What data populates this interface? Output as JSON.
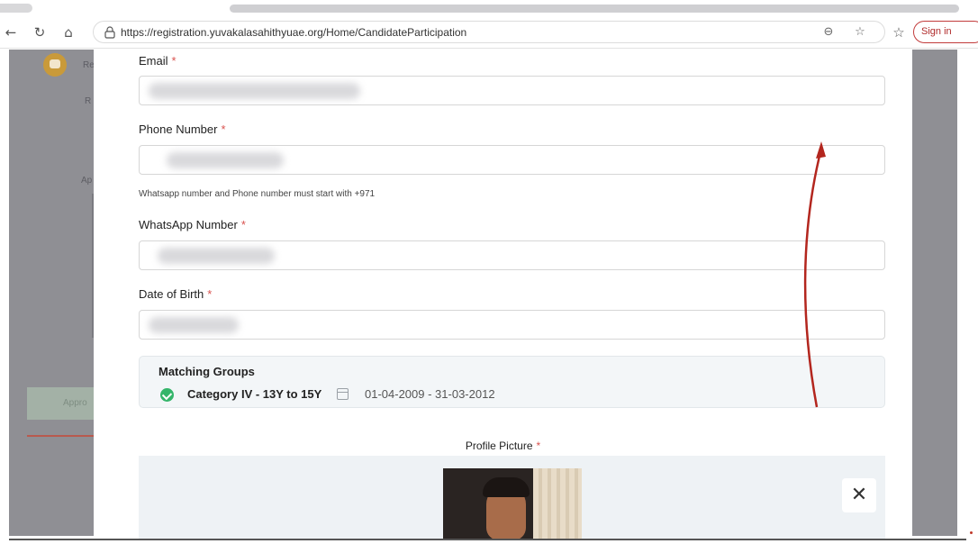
{
  "browser": {
    "url": "https://registration.yuvakalasahithyuae.org/Home/CandidateParticipation",
    "sign_in_label": "Sign in",
    "icons": [
      "back-icon",
      "reload-icon",
      "home-icon",
      "site-info-icon",
      "more-options-icon",
      "favorite-star-icon",
      "favorites-list-icon"
    ]
  },
  "form": {
    "email_label": "Email",
    "phone_label": "Phone Number",
    "phone_hint": "Whatsapp number and Phone number must start with +971",
    "whatsapp_label": "WhatsApp Number",
    "dob_label": "Date of Birth",
    "required_mark": "*",
    "matching_groups": {
      "title": "Matching Groups",
      "category": "Category IV - 13Y to 15Y",
      "date_range": "01-04-2009 - 31-03-2012"
    },
    "profile_picture_label": "Profile Picture",
    "remove_photo_symbol": "✕"
  },
  "background_panel": {
    "approve_label": "Appro"
  },
  "colors": {
    "required": "#d9534f",
    "check_green": "#34b56a",
    "annotation_arrow": "#b3261e"
  }
}
